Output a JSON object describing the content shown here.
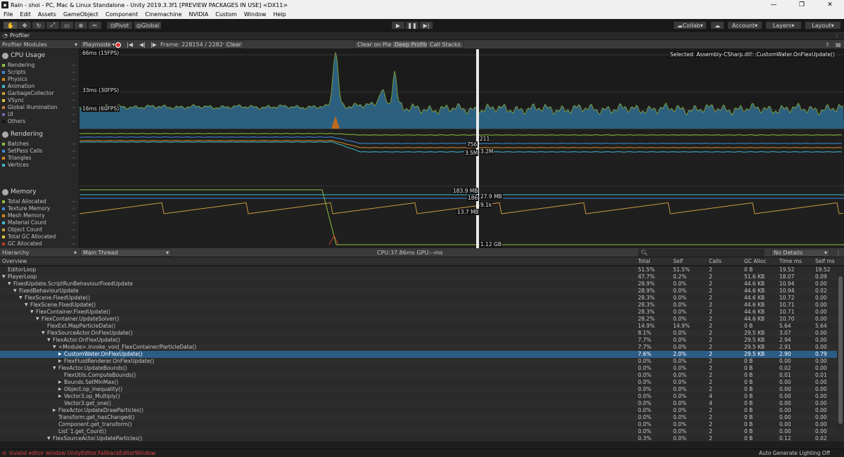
{
  "window": {
    "title": "Rain - shoi - PC, Mac & Linux Standalone - Unity 2019.3.3f1 [PREVIEW PACKAGES IN USE] <DX11>"
  },
  "menu": [
    "File",
    "Edit",
    "Assets",
    "GameObject",
    "Component",
    "Cinemachine",
    "NVIDIA",
    "Custom",
    "Window",
    "Help"
  ],
  "toolbar": {
    "pivot": "Pivot",
    "global": "Global",
    "collab": "Collab",
    "account": "Account",
    "layers": "Layers",
    "layout": "Layout"
  },
  "profiler": {
    "tab": "Profiler",
    "modules_label": "Profiler Modules",
    "playmode": "Playmode",
    "frame": "Frame: 228154 / 228296",
    "clear": "Clear",
    "clear_on_play": "Clear on Play",
    "deep_profile": "Deep Profile",
    "call_stacks": "Call Stacks",
    "selected": "Selected: Assembly-CSharp.dll!::CustomWater.OnFlexUpdate()"
  },
  "modules": {
    "cpu": {
      "title": "CPU Usage",
      "items": [
        {
          "label": "Rendering",
          "color": "#8fbf3f"
        },
        {
          "label": "Scripts",
          "color": "#3f8ad6"
        },
        {
          "label": "Physics",
          "color": "#d68a1f"
        },
        {
          "label": "Animation",
          "color": "#3fb8c8"
        },
        {
          "label": "GarbageCollector",
          "color": "#c89a3f"
        },
        {
          "label": "VSync",
          "color": "#e0c23f"
        },
        {
          "label": "Global Illumination",
          "color": "#c07a3f"
        },
        {
          "label": "UI",
          "color": "#6a6ab8"
        },
        {
          "label": "Others",
          "color": "#111111"
        }
      ]
    },
    "rendering": {
      "title": "Rendering",
      "items": [
        {
          "label": "Batches",
          "color": "#8fbf3f"
        },
        {
          "label": "SetPass Calls",
          "color": "#3f8ad6"
        },
        {
          "label": "Triangles",
          "color": "#d68a1f"
        },
        {
          "label": "Vertices",
          "color": "#3fb8c8"
        }
      ]
    },
    "memory": {
      "title": "Memory",
      "items": [
        {
          "label": "Total Allocated",
          "color": "#8fbf3f"
        },
        {
          "label": "Texture Memory",
          "color": "#3f8ad6"
        },
        {
          "label": "Mesh Memory",
          "color": "#d68a1f"
        },
        {
          "label": "Material Count",
          "color": "#3fb8c8"
        },
        {
          "label": "Object Count",
          "color": "#c89a3f"
        },
        {
          "label": "Total GC Allocated",
          "color": "#e0c23f"
        },
        {
          "label": "GC Allocated",
          "color": "#c03a2a"
        }
      ]
    }
  },
  "chart_labels": {
    "cpu": [
      "66ms (15FPS)",
      "33ms (30FPS)",
      "16ms (60FPS)"
    ],
    "rendering": [
      "211",
      "756",
      "3.5M",
      "3.2M"
    ],
    "memory": [
      "183.9 MB",
      "186",
      "27.9 MB",
      "9.1k",
      "13.7 MB",
      "1.12 GB"
    ]
  },
  "hierarchy": {
    "view": "Hierarchy",
    "thread": "Main Thread",
    "cpu_gpu": "CPU:37.86ms  GPU:--ms",
    "details": "No Details",
    "columns": [
      "Overview",
      "Total",
      "Self",
      "Calls",
      "GC Alloc",
      "Time ms",
      "Self ms"
    ],
    "rows": [
      {
        "indent": 0,
        "arrow": "",
        "name": "EditorLoop",
        "total": "51.5%",
        "self": "51.5%",
        "calls": "2",
        "gc": "0 B",
        "time": "19.52",
        "selfms": "19.52"
      },
      {
        "indent": 0,
        "arrow": "▼",
        "name": "PlayerLoop",
        "total": "47.7%",
        "self": "0.2%",
        "calls": "2",
        "gc": "51.6 KB",
        "time": "18.07",
        "selfms": "0.09"
      },
      {
        "indent": 1,
        "arrow": "▼",
        "name": "FixedUpdate.ScriptRunBehaviourFixedUpdate",
        "total": "28.9%",
        "self": "0.0%",
        "calls": "2",
        "gc": "44.6 KB",
        "time": "10.94",
        "selfms": "0.00"
      },
      {
        "indent": 2,
        "arrow": "▼",
        "name": "FixedBehaviourUpdate",
        "total": "28.9%",
        "self": "0.0%",
        "calls": "2",
        "gc": "44.6 KB",
        "time": "10.94",
        "selfms": "0.02"
      },
      {
        "indent": 3,
        "arrow": "▼",
        "name": "FlexScene.FixedUpdate()",
        "total": "28.3%",
        "self": "0.0%",
        "calls": "2",
        "gc": "44.6 KB",
        "time": "10.72",
        "selfms": "0.00"
      },
      {
        "indent": 4,
        "arrow": "▼",
        "name": "FlexScene.FixedUpdate()",
        "total": "28.3%",
        "self": "0.0%",
        "calls": "2",
        "gc": "44.6 KB",
        "time": "10.71",
        "selfms": "0.00"
      },
      {
        "indent": 5,
        "arrow": "▼",
        "name": "FlexContainer.FixedUpdate()",
        "total": "28.3%",
        "self": "0.0%",
        "calls": "2",
        "gc": "44.6 KB",
        "time": "10.71",
        "selfms": "0.00"
      },
      {
        "indent": 6,
        "arrow": "▼",
        "name": "FlexContainer.UpdateSolver()",
        "total": "28.2%",
        "self": "0.0%",
        "calls": "2",
        "gc": "44.6 KB",
        "time": "10.70",
        "selfms": "0.00"
      },
      {
        "indent": 7,
        "arrow": "",
        "name": "FlexExt.MapParticleData()",
        "total": "14.9%",
        "self": "14.9%",
        "calls": "2",
        "gc": "0 B",
        "time": "5.64",
        "selfms": "5.64"
      },
      {
        "indent": 7,
        "arrow": "▼",
        "name": "FlexSourceActor.OnFlexUpdate()",
        "total": "8.1%",
        "self": "0.0%",
        "calls": "2",
        "gc": "29.5 KB",
        "time": "3.07",
        "selfms": "0.00"
      },
      {
        "indent": 8,
        "arrow": "▼",
        "name": "FlexActor.OnFlexUpdate()",
        "total": "7.7%",
        "self": "0.0%",
        "calls": "2",
        "gc": "29.5 KB",
        "time": "2.94",
        "selfms": "0.00"
      },
      {
        "indent": 9,
        "arrow": "▼",
        "name": "<Module>.invoke_void_FlexContainer/ParticleData()",
        "total": "7.7%",
        "self": "0.0%",
        "calls": "2",
        "gc": "29.5 KB",
        "time": "2.91",
        "selfms": "0.00"
      },
      {
        "indent": 10,
        "arrow": "▶",
        "name": "CustomWater.OnFlexUpdate()",
        "total": "7.6%",
        "self": "2.0%",
        "calls": "2",
        "gc": "29.5 KB",
        "time": "2.90",
        "selfms": "0.79",
        "selected": true
      },
      {
        "indent": 10,
        "arrow": "▶",
        "name": "FlexFluidRenderer.OnFlexUpdate()",
        "total": "0.0%",
        "self": "0.0%",
        "calls": "2",
        "gc": "0 B",
        "time": "0.00",
        "selfms": "0.00"
      },
      {
        "indent": 9,
        "arrow": "▼",
        "name": "FlexActor.UpdateBounds()",
        "total": "0.0%",
        "self": "0.0%",
        "calls": "2",
        "gc": "0 B",
        "time": "0.02",
        "selfms": "0.00"
      },
      {
        "indent": 10,
        "arrow": "",
        "name": "FlexUtils.ComputeBounds()",
        "total": "0.0%",
        "self": "0.0%",
        "calls": "2",
        "gc": "0 B",
        "time": "0.01",
        "selfms": "0.01"
      },
      {
        "indent": 10,
        "arrow": "▶",
        "name": "Bounds.SetMinMax()",
        "total": "0.0%",
        "self": "0.0%",
        "calls": "2",
        "gc": "0 B",
        "time": "0.00",
        "selfms": "0.00"
      },
      {
        "indent": 10,
        "arrow": "▶",
        "name": "Object.op_Inequality()",
        "total": "0.0%",
        "self": "0.0%",
        "calls": "2",
        "gc": "0 B",
        "time": "0.00",
        "selfms": "0.00"
      },
      {
        "indent": 10,
        "arrow": "▶",
        "name": "Vector3.op_Multiply()",
        "total": "0.0%",
        "self": "0.0%",
        "calls": "4",
        "gc": "0 B",
        "time": "0.00",
        "selfms": "0.00"
      },
      {
        "indent": 10,
        "arrow": "",
        "name": "Vector3.get_one()",
        "total": "0.0%",
        "self": "0.0%",
        "calls": "4",
        "gc": "0 B",
        "time": "0.00",
        "selfms": "0.00"
      },
      {
        "indent": 9,
        "arrow": "▶",
        "name": "FlexActor.UpdateDrawParticles()",
        "total": "0.0%",
        "self": "0.0%",
        "calls": "2",
        "gc": "0 B",
        "time": "0.00",
        "selfms": "0.00"
      },
      {
        "indent": 9,
        "arrow": "",
        "name": "Transform.get_hasChanged()",
        "total": "0.0%",
        "self": "0.0%",
        "calls": "2",
        "gc": "0 B",
        "time": "0.00",
        "selfms": "0.00"
      },
      {
        "indent": 9,
        "arrow": "",
        "name": "Component.get_transform()",
        "total": "0.0%",
        "self": "0.0%",
        "calls": "2",
        "gc": "0 B",
        "time": "0.00",
        "selfms": "0.00"
      },
      {
        "indent": 9,
        "arrow": "",
        "name": "List`1.get_Count()",
        "total": "0.0%",
        "self": "0.0%",
        "calls": "2",
        "gc": "0 B",
        "time": "0.00",
        "selfms": "0.00"
      },
      {
        "indent": 8,
        "arrow": "▼",
        "name": "FlexSourceActor.UpdateParticles()",
        "total": "0.3%",
        "self": "0.0%",
        "calls": "2",
        "gc": "0 B",
        "time": "0.12",
        "selfms": "0.02"
      }
    ]
  },
  "status": {
    "error": "Invalid editor window UnityEditor.FallbackEditorWindow",
    "right": "Auto Generate Lighting Off"
  }
}
